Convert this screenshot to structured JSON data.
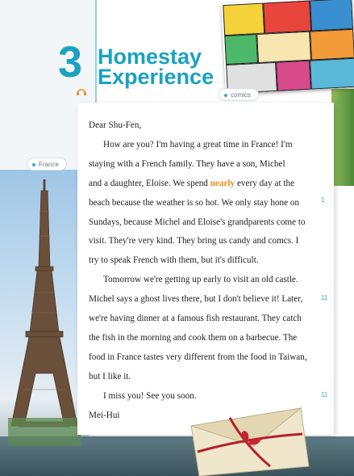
{
  "unit": {
    "number": "3",
    "title_line1": "Homestay",
    "title_line2": "Experience"
  },
  "tags": {
    "comics": "comics",
    "france": "France"
  },
  "letter": {
    "greeting": "Dear Shu-Fen,",
    "p1": [
      "How are you? I'm having a great time in France! I'm",
      "staying with a French family. They have a son, Michel",
      "and a daughter, Eloise. We spend ",
      "nearly",
      " every day at the",
      "beach because the weather is so hot. We only stay hone on",
      "Sundays, because Michel and Eloise's grandparents come to",
      "visit. They're very kind. They bring us candy and comcs. I",
      "try to speak French with them, but it's difficult."
    ],
    "p2": [
      "Tomorrow we're getting up early to visit an old castle.",
      "Michel says a ghost lives there, but I don't believe it! Later,",
      "we're having dinner at a famous fish restaurant. They catch",
      "the fish in the morning and cook them on a barbecue. The",
      "food in France tastes very different from the food in Taiwan,",
      "but I like it."
    ],
    "p3": "I miss you! See you soon.",
    "signature": "Mei-Hui"
  },
  "side_marks": [
    "1",
    "11",
    "11"
  ],
  "colors": {
    "accent": "#1aa2c0",
    "highlight": "#f08a1e"
  }
}
